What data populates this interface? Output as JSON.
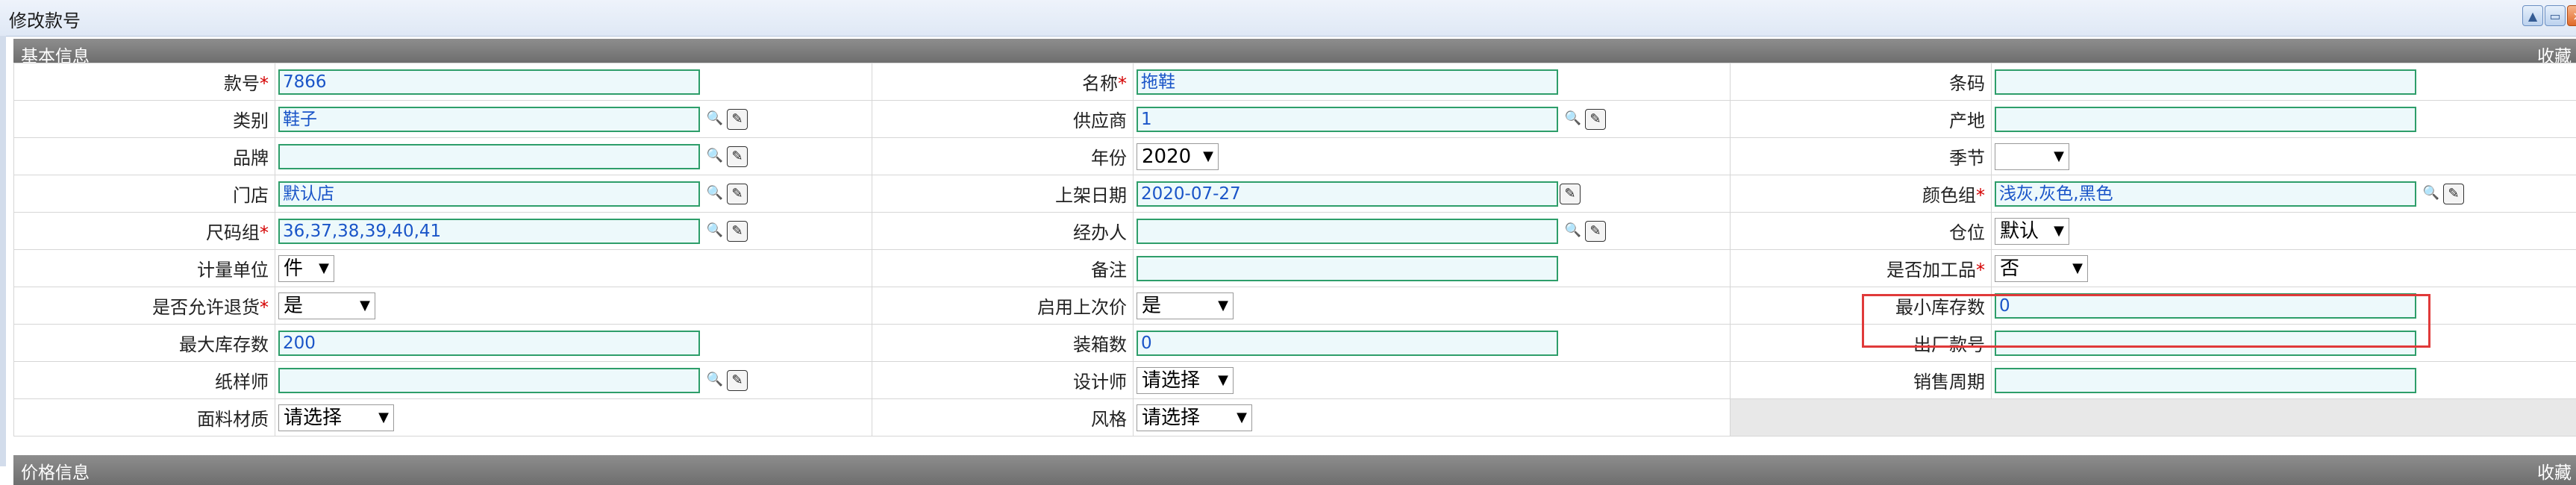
{
  "window": {
    "title": "修改款号",
    "buttons": [
      "▲",
      "▭",
      "×"
    ]
  },
  "section": {
    "title": "基本信息",
    "right_label": "收藏"
  },
  "section2": {
    "title": "价格信息",
    "right_label": "收藏"
  },
  "form": {
    "style_no": {
      "label": "款号",
      "value": "7866"
    },
    "name": {
      "label": "名称",
      "value": "拖鞋"
    },
    "barcode": {
      "label": "条码",
      "value": ""
    },
    "category": {
      "label": "类别",
      "value": "鞋子"
    },
    "supplier": {
      "label": "供应商",
      "value": "1"
    },
    "origin": {
      "label": "产地",
      "value": ""
    },
    "brand": {
      "label": "品牌",
      "value": ""
    },
    "year": {
      "label": "年份",
      "value": "2020"
    },
    "season": {
      "label": "季节",
      "value": ""
    },
    "store": {
      "label": "门店",
      "value": "默认店"
    },
    "listing_date": {
      "label": "上架日期",
      "value": "2020-07-27"
    },
    "color_group": {
      "label": "颜色组",
      "value": "浅灰,灰色,黑色"
    },
    "size_group": {
      "label": "尺码组",
      "value": "36,37,38,39,40,41"
    },
    "handler": {
      "label": "经办人",
      "value": ""
    },
    "location": {
      "label": "仓位",
      "value": "默认"
    },
    "unit": {
      "label": "计量单位",
      "value": "件"
    },
    "remark": {
      "label": "备注",
      "value": ""
    },
    "processed": {
      "label": "是否加工品",
      "value": "否"
    },
    "allow_return": {
      "label": "是否允许退货",
      "value": "是"
    },
    "use_last_price": {
      "label": "启用上次价",
      "value": "是"
    },
    "min_stock": {
      "label": "最小库存数",
      "value": "0"
    },
    "max_stock": {
      "label": "最大库存数",
      "value": "200"
    },
    "pack_qty": {
      "label": "装箱数",
      "value": "0"
    },
    "factory_no": {
      "label": "出厂款号",
      "value": ""
    },
    "pattern_maker": {
      "label": "纸样师",
      "value": ""
    },
    "designer": {
      "label": "设计师",
      "value": "请选择"
    },
    "sales_cycle": {
      "label": "销售周期",
      "value": ""
    },
    "fabric": {
      "label": "面料材质",
      "value": "请选择"
    },
    "style": {
      "label": "风格",
      "value": "请选择"
    }
  },
  "required_mark": "*",
  "select_arrow": "▼",
  "icons": {
    "search": "search-icon",
    "edit": "edit-icon"
  },
  "colors": {
    "input_border": "#2e9e6a",
    "input_bg": "#edf9fb",
    "input_text": "#1a55c8",
    "required": "#d40000",
    "highlight": "#e03a3a"
  }
}
